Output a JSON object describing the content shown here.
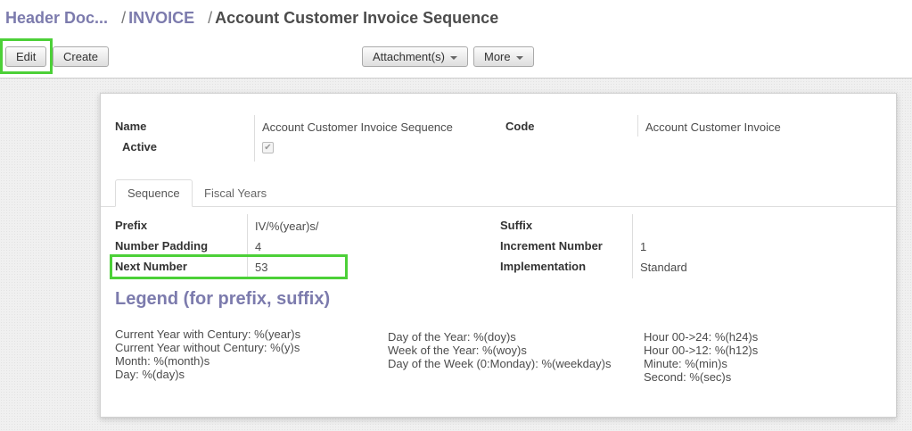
{
  "breadcrumb": {
    "parent": "Header Doc...",
    "model": "INVOICE",
    "separator": "/",
    "current": "Account Customer Invoice Sequence"
  },
  "toolbar": {
    "edit_label": "Edit",
    "create_label": "Create",
    "attachments_label": "Attachment(s)",
    "more_label": "More"
  },
  "form": {
    "name_label": "Name",
    "name_value": "Account Customer Invoice Sequence",
    "code_label": "Code",
    "code_value": "Account Customer Invoice",
    "active_label": "Active",
    "active_checked": true
  },
  "tabs": [
    {
      "label": "Sequence",
      "active": true
    },
    {
      "label": "Fiscal Years",
      "active": false
    }
  ],
  "sequence": {
    "prefix_label": "Prefix",
    "prefix_value": "IV/%(year)s/",
    "padding_label": "Number Padding",
    "padding_value": "4",
    "next_label": "Next Number",
    "next_value": "53",
    "suffix_label": "Suffix",
    "suffix_value": "",
    "increment_label": "Increment Number",
    "increment_value": "1",
    "implementation_label": "Implementation",
    "implementation_value": "Standard"
  },
  "legend": {
    "title": "Legend (for prefix, suffix)",
    "col1": [
      "Current Year with Century: %(year)s",
      "Current Year without Century: %(y)s",
      "Month: %(month)s",
      "Day: %(day)s"
    ],
    "col2": [
      "Day of the Year: %(doy)s",
      "Week of the Year: %(woy)s",
      "Day of the Week (0:Monday): %(weekday)s"
    ],
    "col3": [
      "Hour 00->24: %(h24)s",
      "Hour 00->12: %(h12)s",
      "Minute: %(min)s",
      "Second: %(sec)s"
    ]
  },
  "colors": {
    "link": "#7c7bad",
    "highlight": "#4cd038"
  }
}
